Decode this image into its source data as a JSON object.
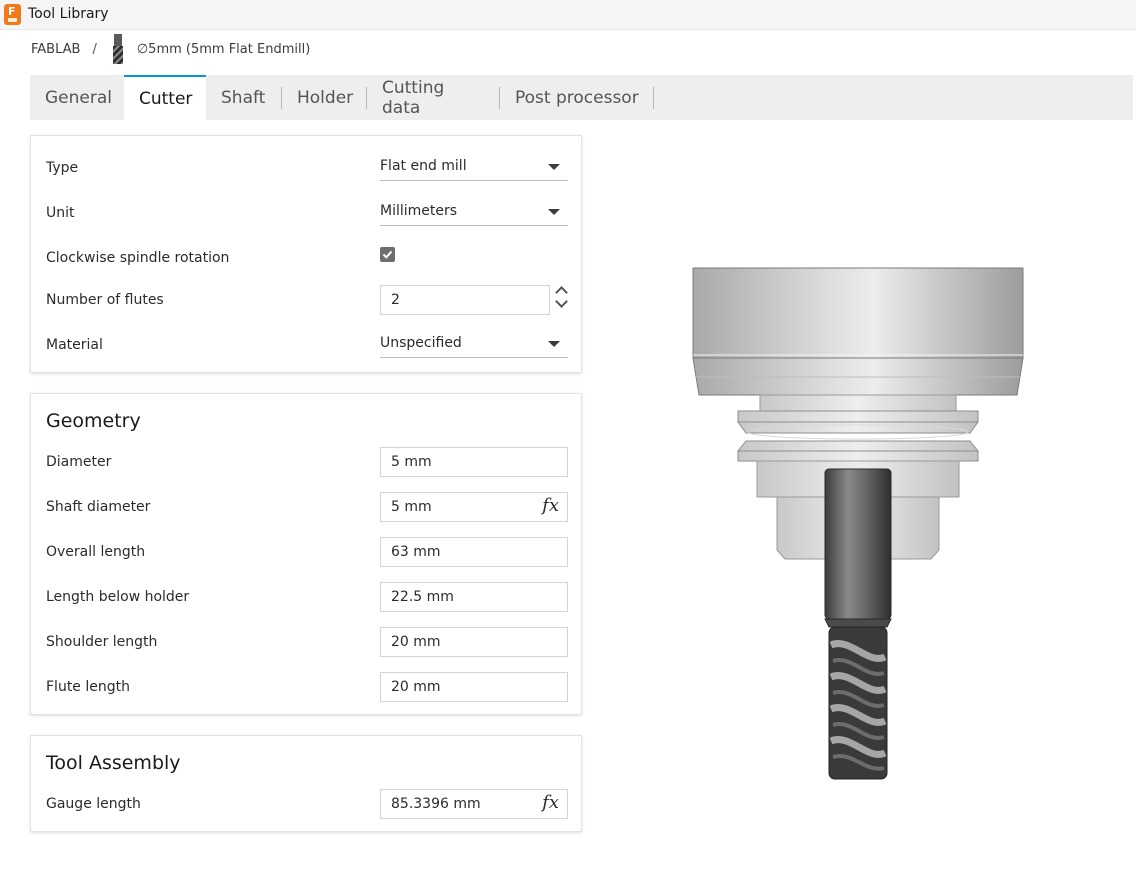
{
  "app": {
    "title": "Tool Library",
    "icon": "fusion-app-icon",
    "icon_letter": "F"
  },
  "breadcrumb": {
    "library": "FABLAB",
    "separator": "/",
    "tool_name": "∅5mm (5mm Flat Endmill)"
  },
  "tabs": [
    {
      "label": "General",
      "active": false
    },
    {
      "label": "Cutter",
      "active": true
    },
    {
      "label": "Shaft",
      "active": false
    },
    {
      "label": "Holder",
      "active": false
    },
    {
      "label": "Cutting data",
      "active": false
    },
    {
      "label": "Post processor",
      "active": false
    }
  ],
  "cutter": {
    "type": {
      "label": "Type",
      "value": "Flat end mill"
    },
    "unit": {
      "label": "Unit",
      "value": "Millimeters"
    },
    "clockwise": {
      "label": "Clockwise spindle rotation",
      "checked": true
    },
    "flutes": {
      "label": "Number of flutes",
      "value": "2"
    },
    "material": {
      "label": "Material",
      "value": "Unspecified"
    }
  },
  "geometry": {
    "title": "Geometry",
    "diameter": {
      "label": "Diameter",
      "value": "5 mm"
    },
    "shaft_diameter": {
      "label": "Shaft diameter",
      "value": "5 mm",
      "fx": "fx"
    },
    "overall_length": {
      "label": "Overall length",
      "value": "63 mm"
    },
    "length_below_holder": {
      "label": "Length below holder",
      "value": "22.5 mm"
    },
    "shoulder_length": {
      "label": "Shoulder length",
      "value": "20 mm"
    },
    "flute_length": {
      "label": "Flute length",
      "value": "20 mm"
    }
  },
  "assembly": {
    "title": "Tool Assembly",
    "gauge_length": {
      "label": "Gauge length",
      "value": "85.3396 mm",
      "fx": "fx"
    }
  },
  "colors": {
    "accent": "#0696d7",
    "brand": "#f07a1a",
    "tab_bar": "#eeeeee"
  }
}
